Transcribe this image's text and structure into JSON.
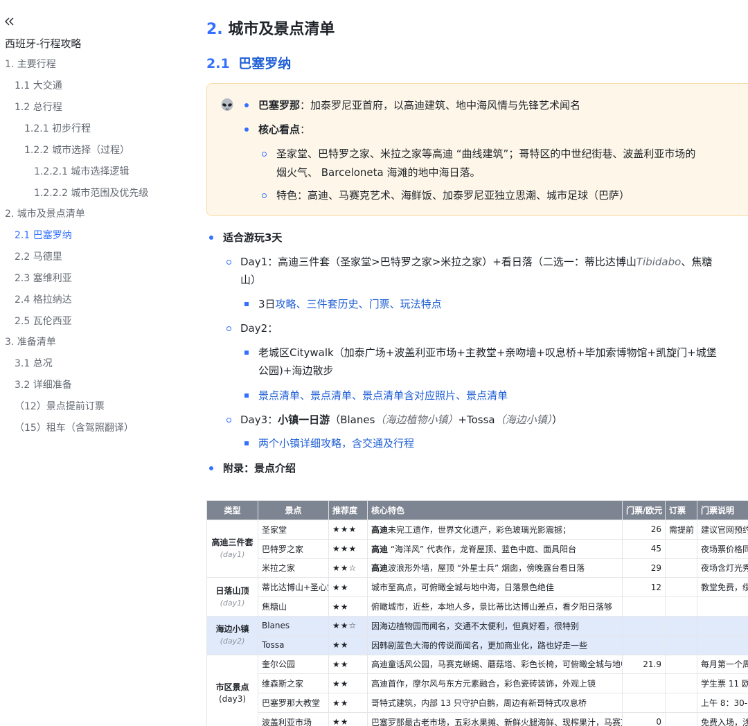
{
  "sidebar": {
    "doc_title": "西班牙-行程攻略",
    "items": [
      {
        "label": "1. 主要行程"
      },
      {
        "label": "1.1 大交通"
      },
      {
        "label": "1.2 总行程"
      },
      {
        "label": "1.2.1 初步行程"
      },
      {
        "label": "1.2.2 城市选择（过程）"
      },
      {
        "label": "1.2.2.1 城市选择逻辑"
      },
      {
        "label": "1.2.2.2 城市范围及优先级"
      },
      {
        "label": "2. 城市及景点清单"
      },
      {
        "label": "2.1 巴塞罗纳"
      },
      {
        "label": "2.2 马德里"
      },
      {
        "label": "2.3 塞维利亚"
      },
      {
        "label": "2.4 格拉纳达"
      },
      {
        "label": "2.5 瓦伦西亚"
      },
      {
        "label": "3. 准备清单"
      },
      {
        "label": "3.1 总况"
      },
      {
        "label": "3.2 详细准备"
      },
      {
        "label": "（12）景点提前订票"
      },
      {
        "label": "（15）租车（含驾照翻译）"
      }
    ]
  },
  "heading2": {
    "num": "2.",
    "text": "城市及景点清单"
  },
  "heading3": {
    "num": "2.1",
    "text": "巴塞罗纳"
  },
  "callout": {
    "emoji": "alien-emoji",
    "b1_bold": "巴塞罗那",
    "b1_text": "：加泰罗尼亚首府，以高迪建筑、地中海风情与先锋艺术闻名",
    "b2_bold": "核心看点",
    "b2_text": "：",
    "s1_line1": "圣家堂、巴特罗之家、米拉之家等高迪 “曲线建筑”；哥特区的中世纪街巷、波盖利亚市场的",
    "s1_line2": "烟火气、 Barceloneta 海滩的地中海日落。",
    "s2": "特色：高迪、马赛克艺术、海鲜饭、加泰罗尼亚独立思潮、城市足球（巴萨）"
  },
  "plan": {
    "title": "适合游玩3天",
    "day1_a": "Day1：高迪三件套（圣家堂>巴特罗之家>米拉之家）+看日落（二选一：蒂比达博山",
    "day1_ital": "Tibidabo",
    "day1_b": "、焦糖",
    "day1_c": "山）",
    "day1_sub_prefix": "3日",
    "day1_links": [
      "攻略",
      "三件套历史",
      "门票",
      "玩法特点"
    ],
    "day2": "Day2：",
    "day2_l1": "老城区Citywalk（加泰广场+波盖利亚市场+主教堂+亲吻墙+叹息桥+毕加索博物馆+凯旋门+城堡",
    "day2_l2": "公园)+海边散步",
    "day2_links": [
      "景点清单",
      "景点清单",
      "景点清单含对应照片",
      "景点清单"
    ],
    "day3_a": "Day3：",
    "day3_bold": "小镇一日游",
    "day3_b": "（Blanes",
    "day3_ital1": "（海边植物小镇）",
    "day3_c": "+Tossa",
    "day3_ital2": "（海边小镇）",
    "day3_d": "）",
    "day3_link": "两个小镇详细攻略，含交通及行程",
    "appendix": "附录：景点介绍",
    "sep": "、"
  },
  "table": {
    "headers": [
      "类型",
      "景点",
      "推荐度",
      "核心特色",
      "门票/欧元",
      "订票",
      "门票说明"
    ],
    "groups": [
      {
        "cat": "高迪三件套",
        "sub": "(day1)"
      },
      {
        "cat": "日落山顶",
        "sub": "(day1)"
      },
      {
        "cat": "海边小镇",
        "sub": "(day2)"
      },
      {
        "cat": "市区景点",
        "sub": "(day3)"
      }
    ],
    "rows": [
      {
        "name": "圣家堂",
        "stars": "★★★",
        "bold": "高迪",
        "feat": "未完工遗作，世界文化遗产，彩色玻璃光影震撼；",
        "price": "26",
        "book": "需提前",
        "note": "建议官网预约"
      },
      {
        "name": "巴特罗之家",
        "stars": "★★★",
        "bold": "高迪",
        "feat": " “海洋风” 代表作，龙脊屋顶、蓝色中庭、面具阳台",
        "price": "45",
        "book": "",
        "note": "夜场票价格同"
      },
      {
        "name": "米拉之家",
        "stars": "★★☆",
        "bold": "高迪",
        "feat": "波浪形外墙，屋顶 “外星士兵” 烟囱，傍晚露台看日落",
        "price": "29",
        "book": "",
        "note": "夜场含灯光秀"
      },
      {
        "name": "蒂比达博山+圣心堂",
        "stars": "★★",
        "bold": "",
        "feat": "城市至高点，可俯瞰全城与地中海，日落景色绝佳",
        "price": "12",
        "book": "",
        "note": "教堂免费，缆"
      },
      {
        "name": "焦糖山",
        "stars": "★★",
        "bold": "",
        "feat": "俯瞰城市，近些，本地人多，景比蒂比达博山差点，看夕阳日落够",
        "price": "",
        "book": "",
        "note": ""
      },
      {
        "name": "Blanes",
        "stars": "★★☆",
        "bold": "",
        "feat": "因海边植物园而闻名，交通不太便利，但真好看，很特别",
        "price": "",
        "book": "",
        "note": ""
      },
      {
        "name": "Tossa",
        "stars": "★★",
        "bold": "",
        "feat": "因韩剧蓝色大海的传说而闻名，更加商业化，路也好走一些",
        "price": "",
        "book": "",
        "note": ""
      },
      {
        "name": "奎尔公园",
        "stars": "★★",
        "bold": "",
        "feat": "高迪童话风公园，马赛克蜥蜴、蘑菇塔、彩色长椅，可俯瞰全城与地中海",
        "price": "21.9",
        "book": "",
        "note": "每月第一个周"
      },
      {
        "name": "维森斯之家",
        "stars": "★★",
        "bold": "",
        "feat": "高迪首作，摩尔风与东方元素融合，彩色瓷砖装饰，外观上镜",
        "price": "",
        "book": "",
        "note": "学生票 11 欧"
      },
      {
        "name": "巴塞罗那大教堂",
        "stars": "★★",
        "bold": "",
        "feat": "哥特式建筑，内部 13 只守护白鹅，周边有新哥特式叹息桥",
        "price": "",
        "book": "",
        "note": "上午 8：30-1"
      },
      {
        "name": "波盖利亚市场",
        "stars": "★★",
        "bold": "",
        "feat": "巴塞罗那最古老市场，五彩水果摊、新鲜火腿海鲜、现榨果汁，马赛克",
        "price": "0",
        "book": "",
        "note": "免费入场，涉"
      }
    ]
  }
}
